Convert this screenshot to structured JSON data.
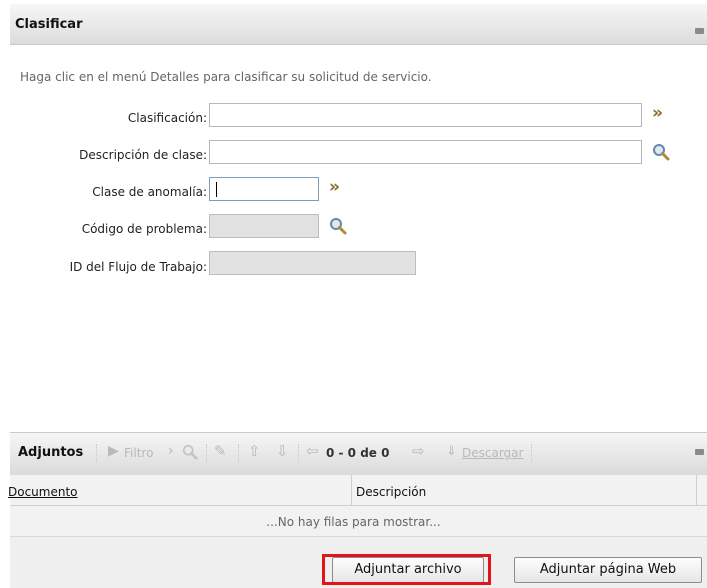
{
  "classify_section": {
    "title": "Clasificar",
    "instructions": "Haga clic en el menú Detalles para clasificar su solicitud de servicio.",
    "fields": {
      "classification": {
        "label": "Clasificación:",
        "value": ""
      },
      "class_description": {
        "label": "Descripción de clase:",
        "value": ""
      },
      "anomaly_class": {
        "label": "Clase de anomalía:",
        "value": ""
      },
      "problem_code": {
        "label": "Código de problema:",
        "value": ""
      },
      "workflow_id": {
        "label": "ID del Flujo de Trabajo:",
        "value": ""
      }
    },
    "icons": {
      "detail_menu": "double-chevron-right-icon",
      "lookup": "magnifier-icon",
      "collapse": "minimize-icon"
    }
  },
  "attachments": {
    "title": "Adjuntos",
    "toolbar": {
      "filter_label": "Filtro",
      "pager_text": "0 - 0 de 0",
      "download_label": "Descargar"
    },
    "columns": [
      "Documento",
      "Descripción"
    ],
    "empty_message": "...No hay filas para mostrar...",
    "buttons": {
      "attach_file": "Adjuntar archivo",
      "attach_web_page": "Adjuntar página Web"
    }
  },
  "colors": {
    "highlight": "#e0151a",
    "toolbar_disabled": "#b9b9b9",
    "readonly_field": "#e2e2e2"
  }
}
